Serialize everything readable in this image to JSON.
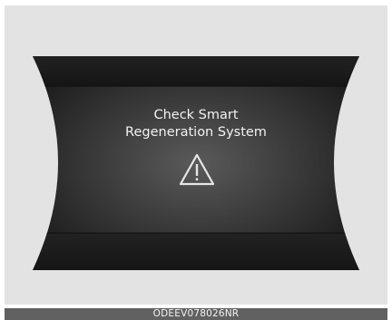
{
  "display": {
    "message_line1": "Check Smart",
    "message_line2": "Regeneration System",
    "icon": "warning-triangle-icon",
    "colors": {
      "background": "#e3e3e3",
      "screen_dark": "#151515",
      "screen_center": "#545454",
      "text": "#f2f2f2"
    }
  },
  "caption": {
    "code": "ODEEV078026NR"
  }
}
